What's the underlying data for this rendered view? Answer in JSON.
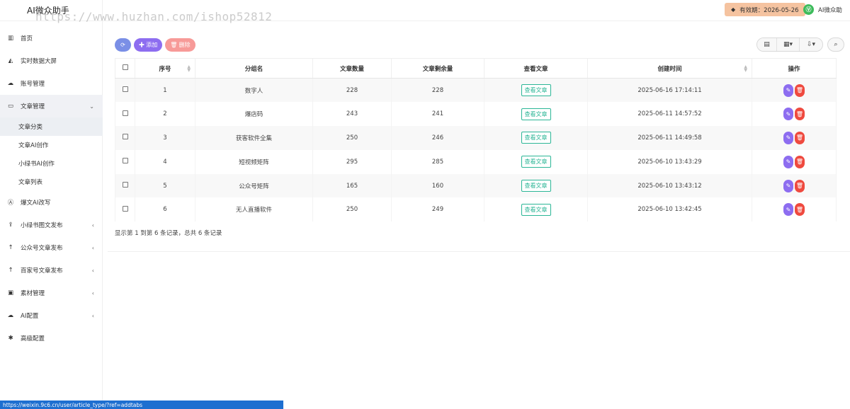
{
  "app": {
    "title": "AI微众助手"
  },
  "watermark": "https://www.huzhan.com/ishop52812",
  "header": {
    "validity_label": "有效期：2026-05-26",
    "user_name": "AI微众助",
    "avatar_text": "Ⓥ"
  },
  "sidebar": {
    "items": [
      {
        "label": "首页",
        "icon": "chart-bar-icon",
        "glyph": "▥"
      },
      {
        "label": "实时数据大屏",
        "icon": "area-chart-icon",
        "glyph": "◭"
      },
      {
        "label": "账号管理",
        "icon": "wechat-icon",
        "glyph": "☁"
      },
      {
        "label": "文章管理",
        "icon": "folder-open-icon",
        "glyph": "▭",
        "arrow": "⌄"
      },
      {
        "label": "爆文AI改写",
        "icon": "ai-icon",
        "glyph": "Ⓐ"
      },
      {
        "label": "小绿书图文发布",
        "icon": "upload-icon",
        "glyph": "⇪",
        "arrow": "‹"
      },
      {
        "label": "公众号文章发布",
        "icon": "arrow-up-icon",
        "glyph": "↑",
        "arrow": "‹"
      },
      {
        "label": "百家号文章发布",
        "icon": "arrow-up-icon",
        "glyph": "↑",
        "arrow": "‹"
      },
      {
        "label": "素材管理",
        "icon": "image-icon",
        "glyph": "▣",
        "arrow": "‹"
      },
      {
        "label": "AI配置",
        "icon": "cloud-icon",
        "glyph": "☁",
        "arrow": "‹"
      },
      {
        "label": "高级配置",
        "icon": "gear-icon",
        "glyph": "✱"
      }
    ],
    "sub_items": [
      "文章分类",
      "文章AI创作",
      "小绿书AI创作",
      "文章列表"
    ]
  },
  "toolbar": {
    "refresh_icon": "⟳",
    "add_label": "✚ 添加",
    "delete_label": "🗑 删除"
  },
  "table": {
    "headers": [
      "序号",
      "分组名",
      "文章数量",
      "文章剩余量",
      "查看文章",
      "创建时间",
      "操作"
    ],
    "view_label": "查看文章",
    "rows": [
      {
        "no": "1",
        "name": "数字人",
        "count": "228",
        "remain": "228",
        "time": "2025-06-16 17:14:11"
      },
      {
        "no": "2",
        "name": "爆店码",
        "count": "243",
        "remain": "241",
        "time": "2025-06-11 14:57:52"
      },
      {
        "no": "3",
        "name": "获客软件全集",
        "count": "250",
        "remain": "246",
        "time": "2025-06-11 14:49:58"
      },
      {
        "no": "4",
        "name": "短视频矩阵",
        "count": "295",
        "remain": "285",
        "time": "2025-06-10 13:43:29"
      },
      {
        "no": "5",
        "name": "公众号矩阵",
        "count": "165",
        "remain": "160",
        "time": "2025-06-10 13:43:12"
      },
      {
        "no": "6",
        "name": "无人直播软件",
        "count": "250",
        "remain": "249",
        "time": "2025-06-10 13:42:45"
      }
    ]
  },
  "pager": {
    "text": "显示第 1 到第 6 条记录，总共 6 条记录"
  },
  "status_url": "https://weixin.9c6.cn/user/article_type/?ref=addtabs"
}
